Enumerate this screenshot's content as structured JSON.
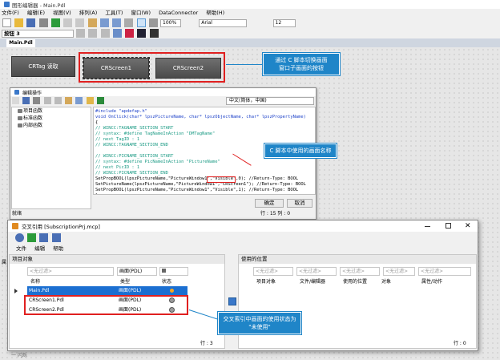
{
  "app": {
    "title": "图形编辑器 - Main.Pdl",
    "menu": [
      "文件(F)",
      "编辑(E)",
      "视图(V)",
      "排列(A)",
      "工具(T)",
      "窗口(W)",
      "DataConnector",
      "帮助(H)"
    ],
    "zoom": "100%",
    "font_name": "Arial",
    "font_size": "12",
    "object_label": "按钮 3",
    "doc_tab": "Main.Pdl"
  },
  "canvas": {
    "buttons": [
      "CRTag 读取",
      "CRScreen1",
      "CRScreen2"
    ]
  },
  "callouts": {
    "top": "通过 C 脚本切换画面\n窗口子画面的按钮",
    "middle": "C 脚本中使用的画面名称",
    "bottom": "交叉索引中画面的使用状态为\n\"未使用\""
  },
  "editor": {
    "title": "编辑操作",
    "language": "中文(简体，中国)",
    "tree": [
      "项目函数",
      "标准函数",
      "内部函数"
    ],
    "code": [
      {
        "text": "#include \"apdefap.h\"",
        "color": "c-blue"
      },
      {
        "text": "void OnClick(char* lpszPictureName, char* lpszObjectName, char* lpszPropertyName)",
        "color": "c-blue"
      },
      {
        "text": "{",
        "color": ""
      },
      {
        "text": "// WINCC:TAGNAME_SECTION_START",
        "color": "c-green"
      },
      {
        "text": "// syntax: #define TagNameInAction \"DMTagName\"",
        "color": "c-green"
      },
      {
        "text": "// next TagID : 1",
        "color": "c-green"
      },
      {
        "text": "// WINCC:TAGNAME_SECTION_END",
        "color": "c-green"
      },
      {
        "text": "",
        "color": ""
      },
      {
        "text": "// WINCC:PICNAME_SECTION_START",
        "color": "c-green"
      },
      {
        "text": "// syntax: #define PicNameInAction \"PictureName\"",
        "color": "c-green"
      },
      {
        "text": "// next PicID : 1",
        "color": "c-green"
      },
      {
        "text": "// WINCC:PICNAME_SECTION_END",
        "color": "c-green"
      },
      {
        "text": "SetPropBOOL(lpszPictureName,\"PictureWindow1\",\"Visible\",0);          //Return-Type: BOOL",
        "color": ""
      },
      {
        "text": "SetPictureName(lpszPictureName,\"PictureWindow1\",\"CRScreen1\");     //Return-Type: BOOL",
        "color": ""
      },
      {
        "text": "SetPropBOOL(lpszPictureName,\"PictureWindow1\",\"Visible\",1);          //Return-Type: BOOL",
        "color": ""
      },
      {
        "text": "}",
        "color": ""
      }
    ],
    "ok": "确定",
    "cancel": "取消",
    "status_left": "就绪",
    "status_right": "行 : 15    列 : 0"
  },
  "xref": {
    "title": "交叉引用 [SubscriptionPrj.mcp]",
    "menu": [
      "文件",
      "编辑",
      "帮助"
    ],
    "left_header": "项目对象",
    "right_header": "使用的位置",
    "filter_placeholder": "<无过滤>",
    "filter_type": "画面(PDL)",
    "left_columns": [
      "名称",
      "类型",
      "状态"
    ],
    "rows": [
      {
        "name": "Main.Pdl",
        "type": "画面(PDL)",
        "selected": true
      },
      {
        "name": "CRScreen1.Pdl",
        "type": "画面(PDL)",
        "selected": false
      },
      {
        "name": "CRScreen2.Pdl",
        "type": "画面(PDL)",
        "selected": false
      }
    ],
    "right_columns": [
      "项目对象",
      "文件/编辑器",
      "使用的位置",
      "对象",
      "属性/动作"
    ],
    "left_status": "行 : 3",
    "right_status": "行 : 0",
    "bg_tab_label": "属",
    "bg_bottom_label": "一 闪烁"
  }
}
